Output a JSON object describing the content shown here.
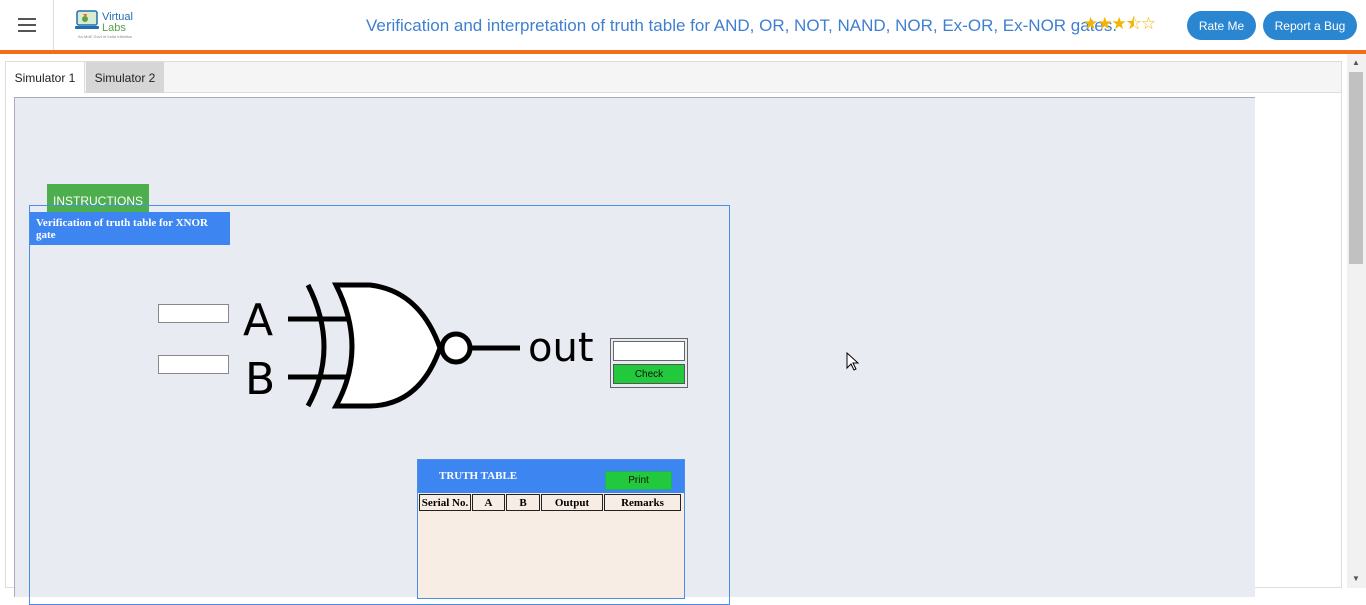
{
  "header": {
    "logo_line1": "Virtual",
    "logo_line2": "Labs",
    "logo_tagline": "An MoE Govt of India Initiative",
    "title": "Verification and interpretation of truth table for AND, OR, NOT, NAND, NOR, Ex-OR, Ex-NOR gates.",
    "rating_stars": "★★★⯪☆",
    "rating": 3.5,
    "rate_button": "Rate Me",
    "bug_button": "Report a Bug"
  },
  "tabs": [
    {
      "label": "Simulator 1"
    },
    {
      "label": "Simulator 2"
    }
  ],
  "simulator": {
    "instructions_button": "INSTRUCTIONS",
    "panel_title": "Verification of truth table for XNOR gate",
    "input_a_value": "",
    "input_b_value": "",
    "output_value": "",
    "gate_label_a": "A",
    "gate_label_b": "B",
    "gate_label_out": "out",
    "check_button": "Check",
    "truth_table": {
      "title": "TRUTH TABLE",
      "print_button": "Print",
      "columns": [
        "Serial No.",
        "A",
        "B",
        "Output",
        "Remarks"
      ]
    }
  },
  "colors": {
    "accent_blue": "#3d86f2",
    "header_orange": "#f26c1c",
    "green": "#4cae4c",
    "check_green": "#22c93d"
  }
}
